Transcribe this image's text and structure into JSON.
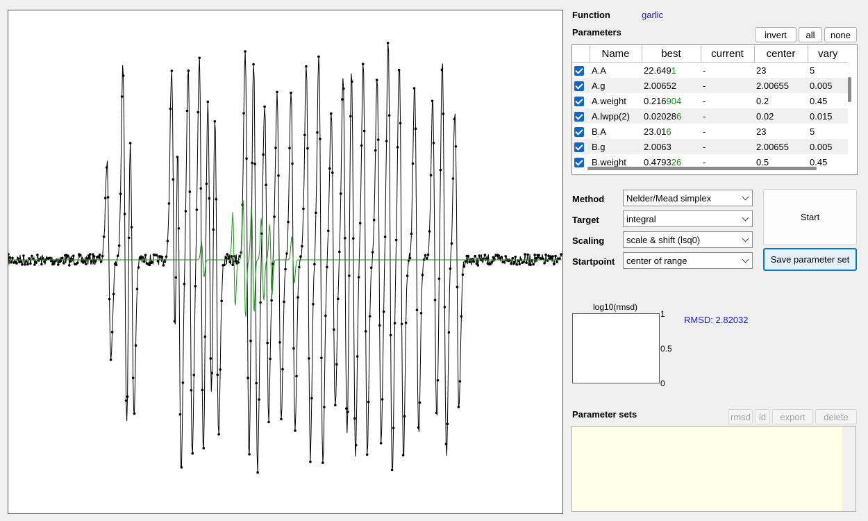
{
  "function": {
    "label": "Function",
    "value": "garlic"
  },
  "parameters": {
    "label": "Parameters",
    "buttons": {
      "invert": "invert",
      "all": "all",
      "none": "none"
    },
    "columns": [
      "Name",
      "best",
      "current",
      "center",
      "vary"
    ],
    "rows": [
      {
        "name": "A.A",
        "best": "22.649",
        "best_hl": "1",
        "current": "-",
        "center": "23",
        "vary": "5"
      },
      {
        "name": "A.g",
        "best": "2.00652",
        "best_hl": "",
        "current": "-",
        "center": "2.00655",
        "vary": "0.005"
      },
      {
        "name": "A.weight",
        "best": "0.216",
        "best_hl": "904",
        "current": "-",
        "center": "0.2",
        "vary": "0.45"
      },
      {
        "name": "A.lwpp(2)",
        "best": "0.02028",
        "best_hl": "6",
        "current": "-",
        "center": "0.02",
        "vary": "0.015"
      },
      {
        "name": "B.A",
        "best": "23.01",
        "best_hl": "6",
        "current": "-",
        "center": "23",
        "vary": "5"
      },
      {
        "name": "B.g",
        "best": "2.0063",
        "best_hl": "",
        "current": "-",
        "center": "2.00655",
        "vary": "0.005"
      },
      {
        "name": "B.weight",
        "best": "0.4793",
        "best_hl": "26",
        "current": "-",
        "center": "0.5",
        "vary": "0.45"
      }
    ]
  },
  "method": {
    "label": "Method",
    "value": "Nelder/Mead simplex"
  },
  "target": {
    "label": "Target",
    "value": "integral"
  },
  "scaling": {
    "label": "Scaling",
    "value": "scale & shift (lsq0)"
  },
  "startpoint": {
    "label": "Startpoint",
    "value": "center of range"
  },
  "start_button": "Start",
  "save_button": "Save parameter set",
  "rmsd_plot": {
    "title": "log10(rmsd)",
    "ticks": [
      "1",
      "0.5",
      "0"
    ],
    "value_text": "RMSD: 2.82032"
  },
  "parameter_sets": {
    "label": "Parameter sets",
    "buttons": {
      "rmsd": "rmsd",
      "id": "id",
      "export": "export",
      "delete": "delete"
    }
  },
  "colors": {
    "experimental": "#000000",
    "simulated": "#119911",
    "accent": "#1a1ad0",
    "checkbox": "#1166cc"
  }
}
